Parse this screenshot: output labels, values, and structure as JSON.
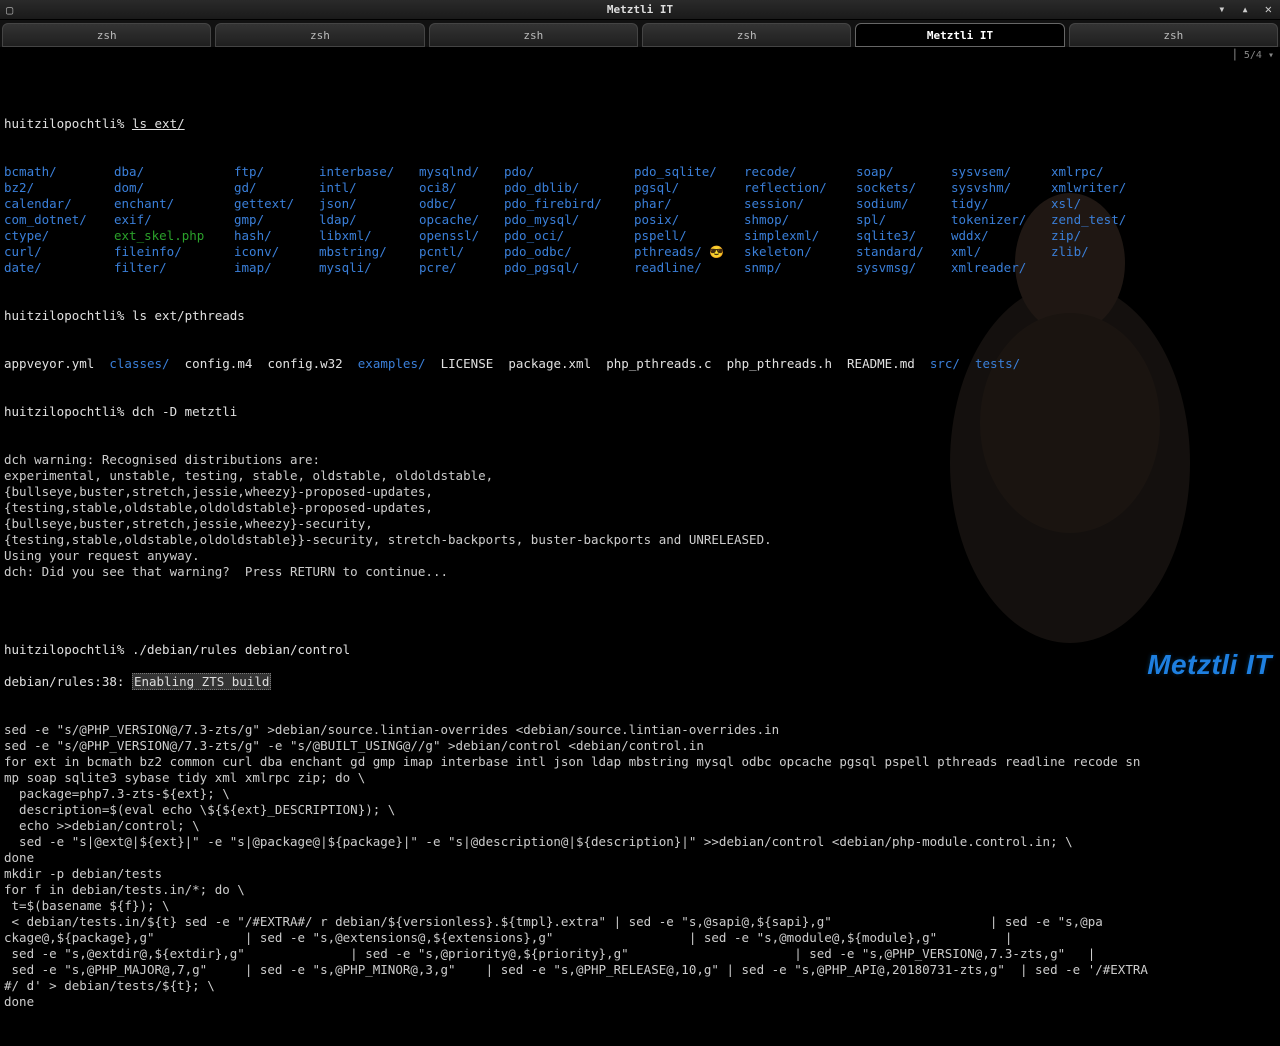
{
  "window": {
    "title": "Metztli IT",
    "icon_left": "▢"
  },
  "window_controls": {
    "min": "▾",
    "max": "▴",
    "close": "✕"
  },
  "tabs": [
    {
      "label": "zsh",
      "active": false
    },
    {
      "label": "zsh",
      "active": false
    },
    {
      "label": "zsh",
      "active": false
    },
    {
      "label": "zsh",
      "active": false
    },
    {
      "label": "Metztli IT",
      "active": true
    },
    {
      "label": "zsh",
      "active": false
    }
  ],
  "indicator": "⎮ 5/4 ▾",
  "prompt_user": "huitzilopochtli%",
  "cmds": {
    "ls_ext": "ls ext/",
    "ls_pthreads": "ls ext/pthreads",
    "dch": "dch -D metztli",
    "rules": "./debian/rules debian/control"
  },
  "ext_columns": {
    "c1": [
      "bcmath/",
      "bz2/",
      "calendar/",
      "com_dotnet/",
      "ctype/",
      "curl/",
      "date/"
    ],
    "c2": [
      "dba/",
      "dom/",
      "enchant/",
      "exif/",
      "ext_skel.php",
      "fileinfo/",
      "filter/"
    ],
    "c3": [
      "ftp/",
      "gd/",
      "gettext/",
      "gmp/",
      "hash/",
      "iconv/",
      "imap/"
    ],
    "c4": [
      "interbase/",
      "intl/",
      "json/",
      "ldap/",
      "libxml/",
      "mbstring/",
      "mysqli/"
    ],
    "c5": [
      "mysqlnd/",
      "oci8/",
      "odbc/",
      "opcache/",
      "openssl/",
      "pcntl/",
      "pcre/"
    ],
    "c6": [
      "pdo/",
      "pdo_dblib/",
      "pdo_firebird/",
      "pdo_mysql/",
      "pdo_oci/",
      "pdo_odbc/",
      "pdo_pgsql/"
    ],
    "c7": [
      "pdo_sqlite/",
      "pgsql/",
      "phar/",
      "posix/",
      "pspell/",
      "pthreads/",
      "readline/"
    ],
    "c8": [
      "recode/",
      "reflection/",
      "session/",
      "shmop/",
      "simplexml/",
      "skeleton/",
      "snmp/"
    ],
    "c9": [
      "soap/",
      "sockets/",
      "sodium/",
      "spl/",
      "sqlite3/",
      "standard/",
      "sysvmsg/"
    ],
    "c10": [
      "sysvsem/",
      "sysvshm/",
      "tidy/",
      "tokenizer/",
      "wddx/",
      "xml/",
      "xmlreader/"
    ],
    "c11": [
      "xmlrpc/",
      "xmlwriter/",
      "xsl/",
      "zend_test/",
      "zip/",
      "zlib/",
      ""
    ]
  },
  "pthreads_row": [
    {
      "t": "appveyor.yml",
      "cls": "white"
    },
    {
      "t": "classes/",
      "cls": "blue"
    },
    {
      "t": "config.m4",
      "cls": "white"
    },
    {
      "t": "config.w32",
      "cls": "white"
    },
    {
      "t": "examples/",
      "cls": "blue"
    },
    {
      "t": "LICENSE",
      "cls": "white"
    },
    {
      "t": "package.xml",
      "cls": "white"
    },
    {
      "t": "php_pthreads.c",
      "cls": "white"
    },
    {
      "t": "php_pthreads.h",
      "cls": "white"
    },
    {
      "t": "README.md",
      "cls": "white"
    },
    {
      "t": "src/",
      "cls": "blue"
    },
    {
      "t": "tests/",
      "cls": "blue"
    }
  ],
  "dch_output": [
    "dch warning: Recognised distributions are:",
    "experimental, unstable, testing, stable, oldstable, oldoldstable,",
    "{bullseye,buster,stretch,jessie,wheezy}-proposed-updates,",
    "{testing,stable,oldstable,oldoldstable}-proposed-updates,",
    "{bullseye,buster,stretch,jessie,wheezy}-security,",
    "{testing,stable,oldstable,oldoldstable}}-security, stretch-backports, buster-backports and UNRELEASED.",
    "Using your request anyway.",
    "dch: Did you see that warning?  Press RETURN to continue..."
  ],
  "rules_highlight_prefix": "debian/rules:38: ",
  "rules_highlight_text": "Enabling ZTS build",
  "rules_output": [
    "sed -e \"s/@PHP_VERSION@/7.3-zts/g\" >debian/source.lintian-overrides <debian/source.lintian-overrides.in",
    "sed -e \"s/@PHP_VERSION@/7.3-zts/g\" -e \"s/@BUILT_USING@//g\" >debian/control <debian/control.in",
    "for ext in bcmath bz2 common curl dba enchant gd gmp imap interbase intl json ldap mbstring mysql odbc opcache pgsql pspell pthreads readline recode sn",
    "mp soap sqlite3 sybase tidy xml xmlrpc zip; do \\",
    "  package=php7.3-zts-${ext}; \\",
    "  description=$(eval echo \\${${ext}_DESCRIPTION}); \\",
    "  echo >>debian/control; \\",
    "  sed -e \"s|@ext@|${ext}|\" -e \"s|@package@|${package}|\" -e \"s|@description@|${description}|\" >>debian/control <debian/php-module.control.in; \\",
    "done",
    "mkdir -p debian/tests",
    "for f in debian/tests.in/*; do \\",
    " t=$(basename ${f}); \\",
    " < debian/tests.in/${t} sed -e \"/#EXTRA#/ r debian/${versionless}.${tmpl}.extra\" | sed -e \"s,@sapi@,${sapi},g\"                     | sed -e \"s,@pa",
    "ckage@,${package},g\"            | sed -e \"s,@extensions@,${extensions},g\"                  | sed -e \"s,@module@,${module},g\"         |",
    " sed -e \"s,@extdir@,${extdir},g\"              | sed -e \"s,@priority@,${priority},g\"                      | sed -e \"s,@PHP_VERSION@,7.3-zts,g\"   |",
    " sed -e \"s,@PHP_MAJOR@,7,g\"     | sed -e \"s,@PHP_MINOR@,3,g\"    | sed -e \"s,@PHP_RELEASE@,10,g\" | sed -e \"s,@PHP_API@,20180731-zts,g\"  | sed -e '/#EXTRA",
    "#/ d' > debian/tests/${t}; \\",
    "done"
  ],
  "watermark": "Metztli IT",
  "emoji": "😎"
}
